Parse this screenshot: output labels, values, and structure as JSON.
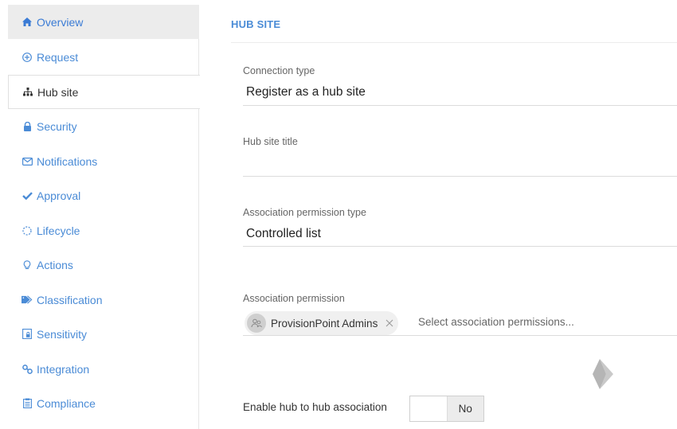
{
  "sidebar": {
    "items": [
      {
        "label": "Overview",
        "icon": "home-icon"
      },
      {
        "label": "Request",
        "icon": "plus-circle-icon"
      },
      {
        "label": "Hub site",
        "icon": "sitemap-icon"
      },
      {
        "label": "Security",
        "icon": "lock-icon"
      },
      {
        "label": "Notifications",
        "icon": "envelope-icon"
      },
      {
        "label": "Approval",
        "icon": "check-icon"
      },
      {
        "label": "Lifecycle",
        "icon": "spinner-icon"
      },
      {
        "label": "Actions",
        "icon": "lightbulb-icon"
      },
      {
        "label": "Classification",
        "icon": "tags-icon"
      },
      {
        "label": "Sensitivity",
        "icon": "sensitivity-label-icon"
      },
      {
        "label": "Integration",
        "icon": "link-icon"
      },
      {
        "label": "Compliance",
        "icon": "clipboard-icon"
      }
    ]
  },
  "main": {
    "section_title": "HUB SITE",
    "connection_type": {
      "label": "Connection type",
      "value": "Register as a hub site"
    },
    "hub_site_title": {
      "label": "Hub site title",
      "value": ""
    },
    "association_permission_type": {
      "label": "Association permission type",
      "value": "Controlled list"
    },
    "association_permission": {
      "label": "Association permission",
      "chips": [
        {
          "label": "ProvisionPoint Admins"
        }
      ],
      "placeholder": "Select association permissions..."
    },
    "hub_to_hub": {
      "label": "Enable hub to hub association",
      "state": "No"
    }
  },
  "colors": {
    "accent": "#4a8bd6",
    "sidebar_selected_bg": "#ececec"
  }
}
